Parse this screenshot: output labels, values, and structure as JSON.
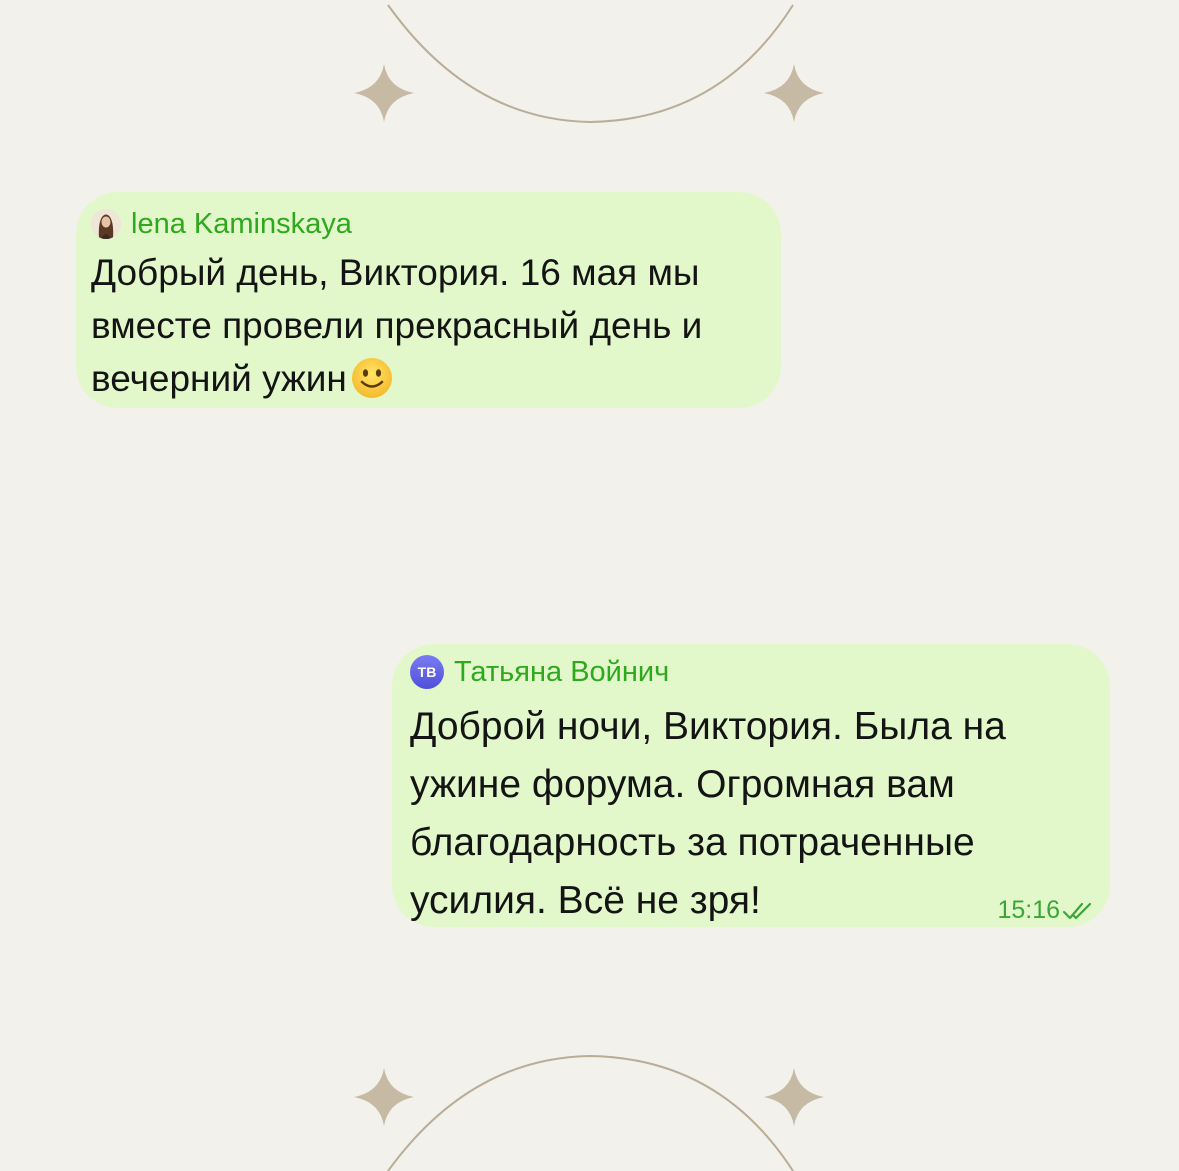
{
  "messages": [
    {
      "sender": "lena Kaminskaya",
      "avatar": "woman-photo-avatar",
      "text": "Добрый день, Виктория. 16 мая мы вместе провели прекрасный день и вечерний ужин",
      "emoji": "slightly-smiling-face-emoji"
    },
    {
      "sender": "Татьяна Войнич",
      "avatar_initials": "ТВ",
      "text": "Доброй ночи, Виктория. Была на ужине форума. Огромная вам благодарность за потраченные усилия. Всё не зря!",
      "time": "15:16",
      "status_icon": "double-check-icon"
    }
  ],
  "colors": {
    "background": "#f3f1ec",
    "bubble": "#e2f8cb",
    "sender_name": "#2ea81d",
    "text": "#141414",
    "decoration": "#c4b8a2",
    "avatar_gradient": "#5b5be0"
  },
  "decorations": [
    "sparkle-star-icon",
    "sparkle-star-icon",
    "sparkle-star-icon",
    "sparkle-star-icon",
    "arc-line",
    "arc-line"
  ]
}
